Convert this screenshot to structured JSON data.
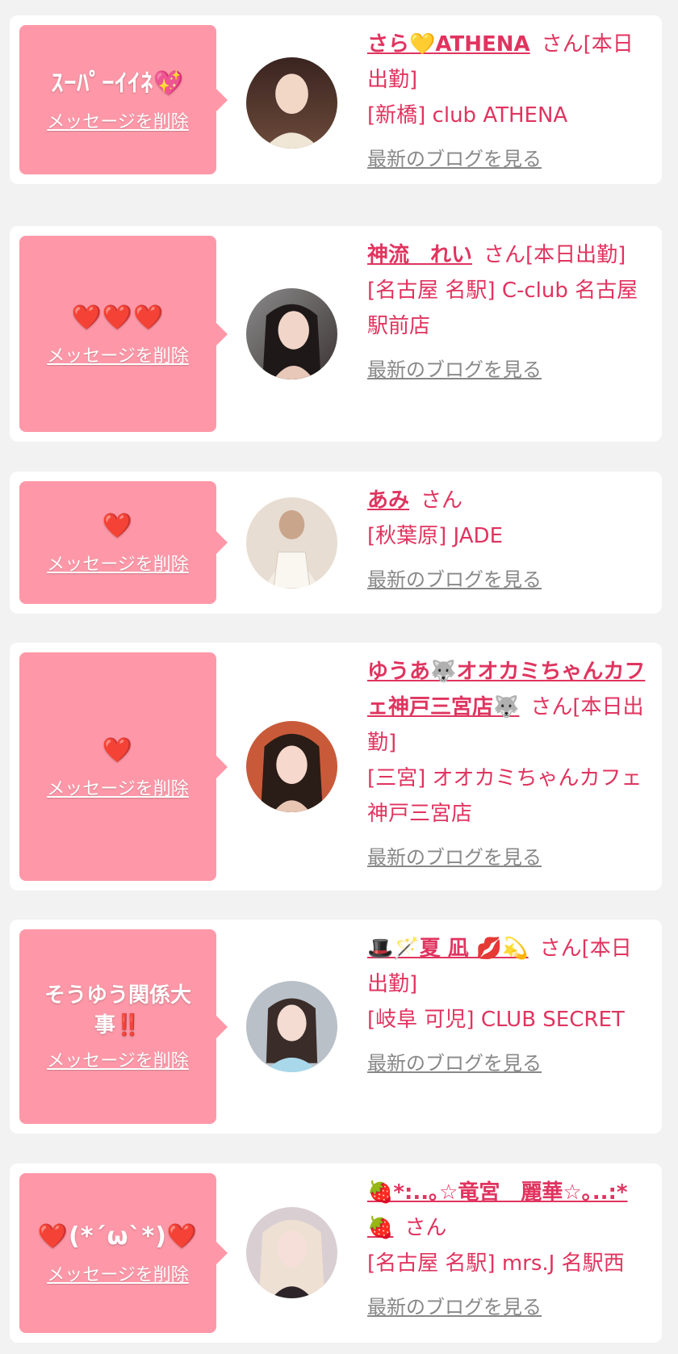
{
  "common": {
    "delete_label": "メッセージを削除",
    "blog_label": "最新のブログを見る",
    "san": "さん"
  },
  "colors": {
    "page_bg": "#f2f2f2",
    "card_bg": "#ffffff",
    "message_bg": "#fe98a8",
    "accent_text": "#e0345f",
    "blog_link": "#888888"
  },
  "items": [
    {
      "message": "ｽｰﾊﾟｰｲｲﾈ💖",
      "name": "さら💛ATHENA",
      "status": "[本日出勤]",
      "shop": "[新橋] club ATHENA"
    },
    {
      "message": "❤️❤️❤️",
      "name": "神流　れい",
      "status": "[本日出勤]",
      "shop": "[名古屋 名駅] C-club 名古屋駅前店"
    },
    {
      "message": "❤️",
      "name": "あみ",
      "status": "",
      "shop": "[秋葉原] JADE"
    },
    {
      "message": "❤️",
      "name": "ゆうあ🐺オオカミちゃんカフェ神戸三宮店🐺",
      "status": "[本日出勤]",
      "shop": "[三宮] オオカミちゃんカフェ神戸三宮店"
    },
    {
      "message": "そうゆう関係大事‼️",
      "name": "🎩🪄夏 凪 💋💫",
      "status": "[本日出勤]",
      "shop": "[岐阜 可児] CLUB SECRET"
    },
    {
      "message": "❤️(*´ω`*)❤️",
      "name": "🍓*:..｡☆竜宮　麗華☆｡..:*🍓",
      "status": "",
      "shop": "[名古屋 名駅] mrs.J 名駅西"
    }
  ]
}
